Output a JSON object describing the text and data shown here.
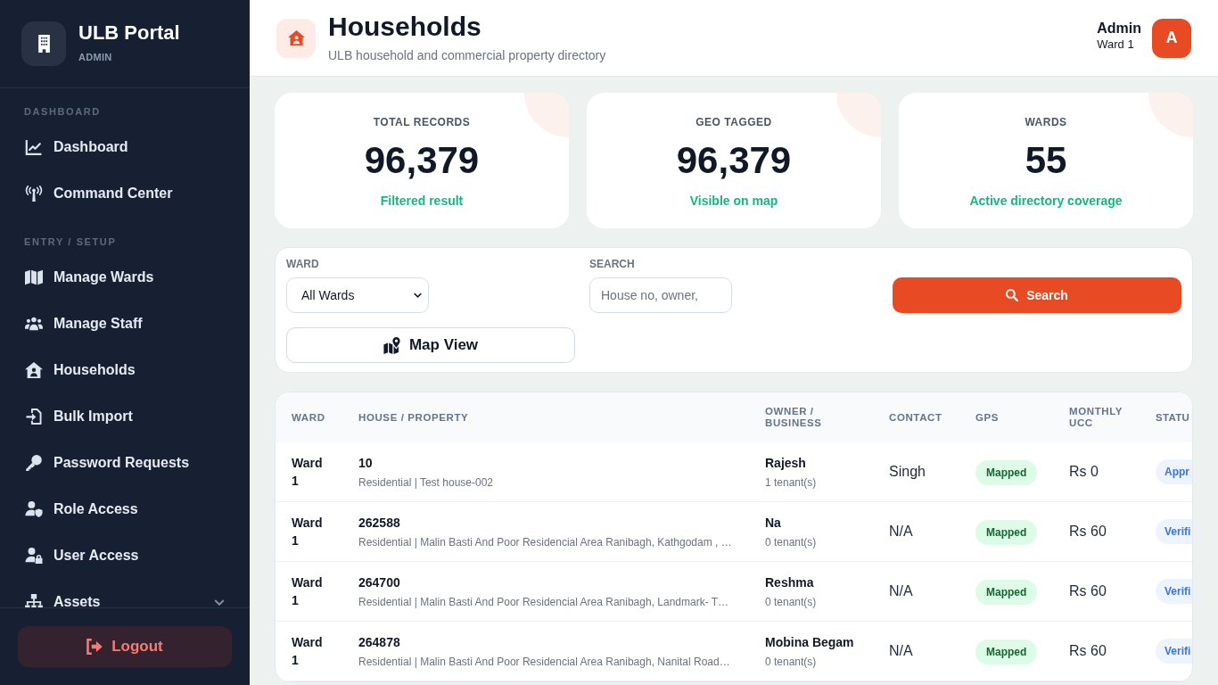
{
  "sidebar": {
    "brand": {
      "title": "ULB Portal",
      "subtitle": "ADMIN"
    },
    "sections": [
      {
        "label": "DASHBOARD",
        "items": [
          {
            "label": "Dashboard",
            "kind": "link",
            "selected": false
          },
          {
            "label": "Command Center",
            "kind": "link",
            "selected": false
          }
        ]
      },
      {
        "label": "ENTRY / SETUP",
        "items": [
          {
            "label": "Manage Wards",
            "kind": "link",
            "selected": false
          },
          {
            "label": "Manage Staff",
            "kind": "link",
            "selected": false
          },
          {
            "label": "Households",
            "kind": "link",
            "selected": false
          },
          {
            "label": "Bulk Import",
            "kind": "link",
            "selected": false
          },
          {
            "label": "Password Requests",
            "kind": "link",
            "selected": false
          },
          {
            "label": "Role Access",
            "kind": "link",
            "selected": false
          },
          {
            "label": "User Access",
            "kind": "link",
            "selected": false
          },
          {
            "label": "Assets",
            "kind": "group",
            "selected": false,
            "expanded": false
          }
        ]
      }
    ],
    "logout": "Logout"
  },
  "header": {
    "title": "Households",
    "subtitle": "ULB household and commercial property directory",
    "user": {
      "name": "Admin",
      "ward": "Ward 1",
      "initial": "A"
    }
  },
  "stats": [
    {
      "label": "TOTAL RECORDS",
      "value": "96,379",
      "note": "Filtered result"
    },
    {
      "label": "GEO TAGGED",
      "value": "96,379",
      "note": "Visible on map"
    },
    {
      "label": "WARDS",
      "value": "55",
      "note": "Active directory coverage"
    }
  ],
  "filters": {
    "ward": {
      "label": "WARD",
      "value": "All Wards"
    },
    "search": {
      "label": "SEARCH",
      "placeholder": "House no, owner,"
    },
    "search_button": "Search",
    "map_button": "Map View"
  },
  "table": {
    "columns": [
      "WARD",
      "HOUSE / PROPERTY",
      "OWNER / BUSINESS",
      "CONTACT",
      "GPS",
      "MONTHLY UCC",
      "STATU"
    ],
    "rows": [
      {
        "ward": "Ward 1",
        "house_no": "10",
        "property": "Residential | Test house-002",
        "owner": "Rajesh",
        "tenants": "1 tenant(s)",
        "contact": "Singh",
        "gps": "Mapped",
        "ucc": "Rs 0",
        "status": "Appr"
      },
      {
        "ward": "Ward 1",
        "house_no": "262588",
        "property": "Residential | Malin Basti And Poor Residencial Area Ranibagh, Kathgodam , …",
        "owner": "Na",
        "tenants": "0 tenant(s)",
        "contact": "N/A",
        "gps": "Mapped",
        "ucc": "Rs 60",
        "status": "Verifi"
      },
      {
        "ward": "Ward 1",
        "house_no": "264700",
        "property": "Residential | Malin Basti And Poor Residencial Area Ranibagh, Landmark- T…",
        "owner": "Reshma",
        "tenants": "0 tenant(s)",
        "contact": "N/A",
        "gps": "Mapped",
        "ucc": "Rs 60",
        "status": "Verifi"
      },
      {
        "ward": "Ward 1",
        "house_no": "264878",
        "property": "Residential | Malin Basti And Poor Residencial Area Ranibagh, Nanital Road…",
        "owner": "Mobina Begam",
        "tenants": "0 tenant(s)",
        "contact": "N/A",
        "gps": "Mapped",
        "ucc": "Rs 60",
        "status": "Verifi"
      }
    ]
  }
}
